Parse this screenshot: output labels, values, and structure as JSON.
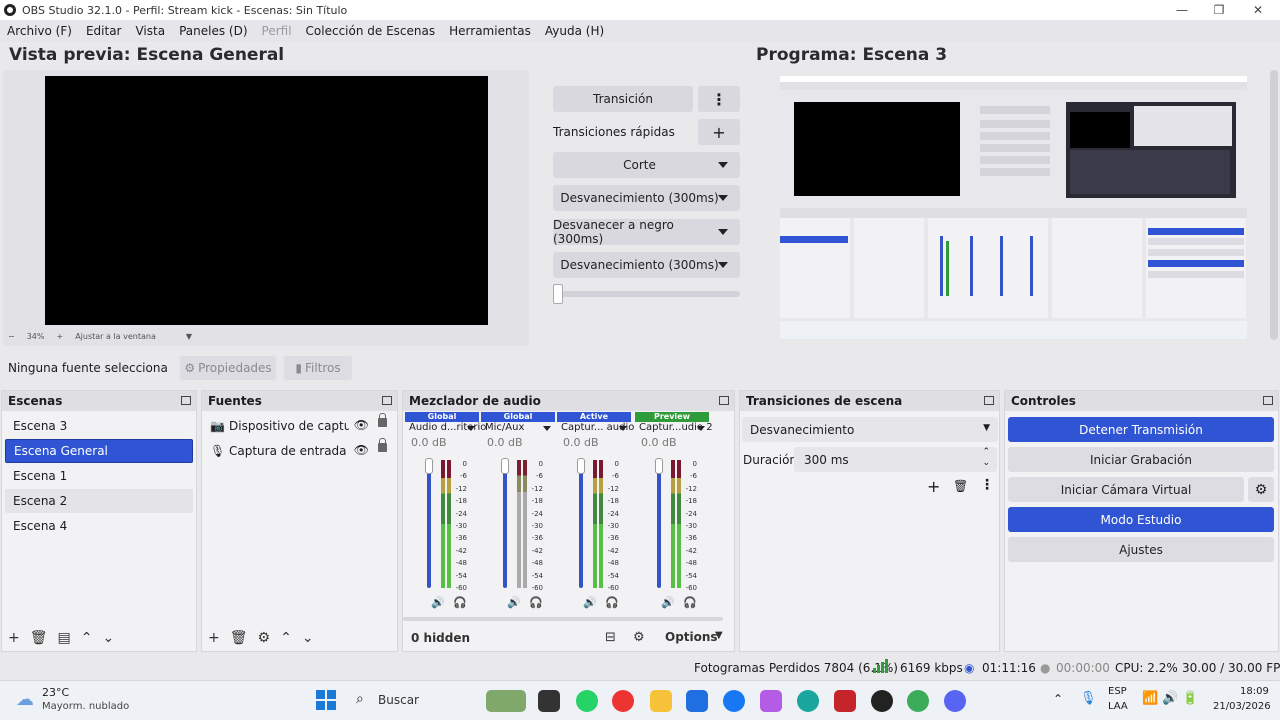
{
  "window": {
    "title": "OBS Studio 32.1.0 - Perfil: Stream kick - Escenas: Sin Título",
    "minimize": "—",
    "maximize": "❐",
    "close": "✕"
  },
  "menu": {
    "archivo": "Archivo (F)",
    "editar": "Editar",
    "vista": "Vista",
    "paneles": "Paneles (D)",
    "perfil": "Perfil",
    "coleccion": "Colección de Escenas",
    "herramientas": "Herramientas",
    "ayuda": "Ayuda (H)"
  },
  "preview": {
    "title": "Vista previa: Escena General",
    "zoom": "34%",
    "minus": "−",
    "plus": "+",
    "fit": "Ajustar a la ventana"
  },
  "program": {
    "title": "Programa: Escena 3"
  },
  "studio_transition": {
    "transition_label": "Transición",
    "quick_label": "Transiciones rápidas",
    "quick_buttons": [
      "Corte",
      "Desvanecimiento (300ms)",
      "Desvanecer a negro (300ms)",
      "Desvanecimiento (300ms)"
    ]
  },
  "source_toolbar": {
    "no_source": "Ninguna fuente selecciona",
    "properties": "Propiedades",
    "filters": "Filtros"
  },
  "scenes": {
    "title": "Escenas",
    "items": [
      "Escena 3",
      "Escena General",
      "Escena 1",
      "Escena 2",
      "Escena 4"
    ],
    "selected": "Escena General"
  },
  "sources": {
    "title": "Fuentes",
    "items": [
      "Dispositivo de captura d",
      "Captura de entrada aud"
    ]
  },
  "mixer": {
    "title": "Mezclador de audio",
    "channels": [
      {
        "badge": "Global",
        "badge_color": "#2f55d4",
        "name": "Audio d...ritorio",
        "db": "0.0 dB",
        "fader": 1.0,
        "muted": false
      },
      {
        "badge": "Global",
        "badge_color": "#2f55d4",
        "name": "Mic/Aux",
        "db": "0.0 dB",
        "fader": 1.0,
        "muted": true
      },
      {
        "badge": "Active",
        "badge_color": "#2f55d4",
        "name": "Captur... audio",
        "db": "0.0 dB",
        "fader": 1.0,
        "muted": false
      },
      {
        "badge": "Preview",
        "badge_color": "#2e9c3a",
        "name": "Captur...udio 2",
        "db": "0.0 dB",
        "fader": 1.0,
        "muted": false
      }
    ],
    "scale": [
      "0",
      "-6",
      "-12",
      "-18",
      "-24",
      "-30",
      "-36",
      "-42",
      "-48",
      "-54",
      "-60"
    ],
    "hidden": "0 hidden",
    "options": "Options"
  },
  "scene_transitions": {
    "title": "Transiciones de escena",
    "selected": "Desvanecimiento",
    "duration_label": "Duración",
    "duration_value": "300 ms"
  },
  "controls": {
    "title": "Controles",
    "stop_stream": "Detener Transmisión",
    "start_recording": "Iniciar Grabación",
    "start_virtual_cam": "Iniciar Cámara Virtual",
    "studio_mode": "Modo Estudio",
    "settings": "Ajustes"
  },
  "status": {
    "dropped": "Fotogramas Perdidos 7804 (6.1%)",
    "kbps": "6169 kbps",
    "stream_time": "01:11:16",
    "rec_time": "00:00:00",
    "cpu": "CPU: 2.2%",
    "fps": "30.00 / 30.00 FPS"
  },
  "taskbar": {
    "weather_temp": "23°C",
    "weather_desc": "Mayorm. nublado",
    "search": "Buscar",
    "lang1": "ESP",
    "lang2": "LAA",
    "time": "18:09",
    "date": "21/03/2026"
  }
}
